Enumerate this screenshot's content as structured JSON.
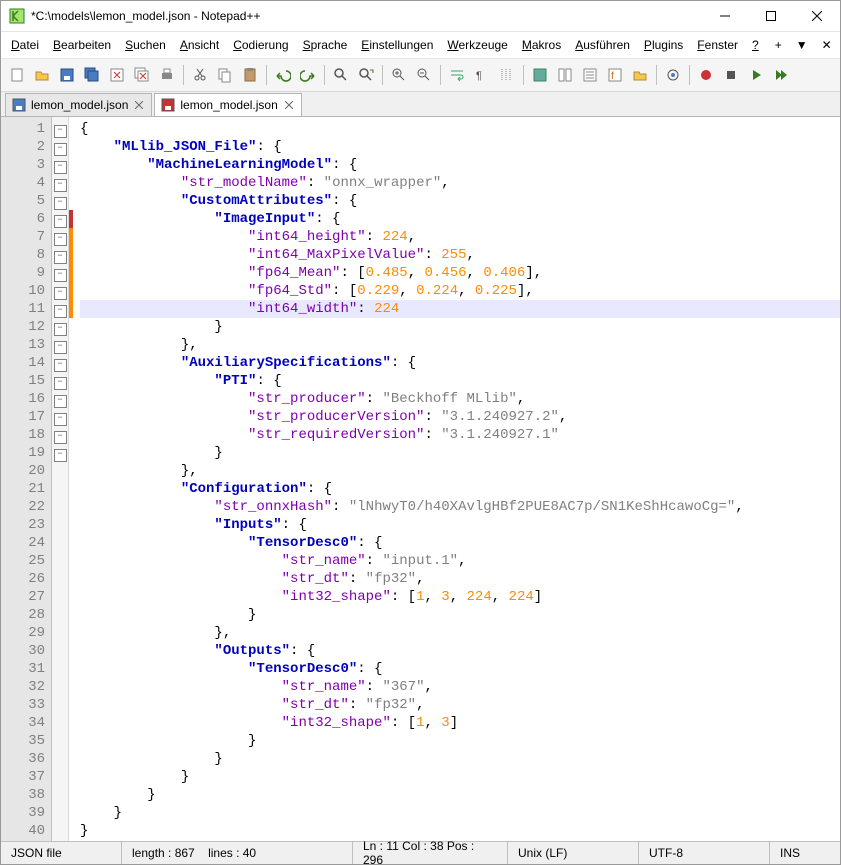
{
  "window": {
    "title": "*C:\\models\\lemon_model.json - Notepad++"
  },
  "menu": {
    "items": [
      "Datei",
      "Bearbeiten",
      "Suchen",
      "Ansicht",
      "Codierung",
      "Sprache",
      "Einstellungen",
      "Werkzeuge",
      "Makros",
      "Ausführen",
      "Plugins",
      "Fenster",
      "?"
    ]
  },
  "tabs": [
    {
      "label": "lemon_model.json",
      "modified": false,
      "active": false
    },
    {
      "label": "lemon_model.json",
      "modified": true,
      "active": true
    }
  ],
  "editor": {
    "current_line": 11,
    "change_marks": {
      "red": [
        6
      ],
      "orange": [
        7,
        8,
        9,
        10,
        11
      ]
    },
    "lines": [
      {
        "n": 1,
        "fold": "-",
        "html": "<span class='b'>{</span>"
      },
      {
        "n": 2,
        "fold": "-",
        "html": "    <span class='kb'>\"MLlib_JSON_File\"</span><span class='b'>: {</span>"
      },
      {
        "n": 3,
        "fold": "-",
        "html": "        <span class='kb'>\"MachineLearningModel\"</span><span class='b'>: {</span>"
      },
      {
        "n": 4,
        "fold": "",
        "html": "            <span class='p'>\"str_modelName\"</span><span class='b'>: </span><span class='s'>\"onnx_wrapper\"</span><span class='b'>,</span>"
      },
      {
        "n": 5,
        "fold": "-",
        "html": "            <span class='kb'>\"CustomAttributes\"</span><span class='b'>: {</span>"
      },
      {
        "n": 6,
        "fold": "-",
        "html": "                <span class='kb'>\"ImageInput\"</span><span class='b'>: {</span>"
      },
      {
        "n": 7,
        "fold": "",
        "html": "                    <span class='p'>\"int64_height\"</span><span class='b'>: </span><span class='n'>224</span><span class='b'>,</span>"
      },
      {
        "n": 8,
        "fold": "",
        "html": "                    <span class='p'>\"int64_MaxPixelValue\"</span><span class='b'>: </span><span class='n'>255</span><span class='b'>,</span>"
      },
      {
        "n": 9,
        "fold": "",
        "html": "                    <span class='p'>\"fp64_Mean\"</span><span class='b'>: [</span><span class='n'>0.485</span><span class='b'>, </span><span class='n'>0.456</span><span class='b'>, </span><span class='n'>0.406</span><span class='b'>],</span>"
      },
      {
        "n": 10,
        "fold": "",
        "html": "                    <span class='p'>\"fp64_Std\"</span><span class='b'>: [</span><span class='n'>0.229</span><span class='b'>, </span><span class='n'>0.224</span><span class='b'>, </span><span class='n'>0.225</span><span class='b'>],</span>"
      },
      {
        "n": 11,
        "fold": "",
        "html": "                    <span class='p'>\"int64_width\"</span><span class='b'>: </span><span class='n'>224</span>"
      },
      {
        "n": 12,
        "fold": "-",
        "html": "                <span class='b'>}</span>"
      },
      {
        "n": 13,
        "fold": "",
        "html": "            <span class='b'>},</span>"
      },
      {
        "n": 14,
        "fold": "-",
        "html": "            <span class='kb'>\"AuxiliarySpecifications\"</span><span class='b'>: {</span>"
      },
      {
        "n": 15,
        "fold": "-",
        "html": "                <span class='kb'>\"PTI\"</span><span class='b'>: {</span>"
      },
      {
        "n": 16,
        "fold": "",
        "html": "                    <span class='p'>\"str_producer\"</span><span class='b'>: </span><span class='s'>\"Beckhoff MLlib\"</span><span class='b'>,</span>"
      },
      {
        "n": 17,
        "fold": "",
        "html": "                    <span class='p'>\"str_producerVersion\"</span><span class='b'>: </span><span class='s'>\"3.1.240927.2\"</span><span class='b'>,</span>"
      },
      {
        "n": 18,
        "fold": "",
        "html": "                    <span class='p'>\"str_requiredVersion\"</span><span class='b'>: </span><span class='s'>\"3.1.240927.1\"</span>"
      },
      {
        "n": 19,
        "fold": "-",
        "html": "                <span class='b'>}</span>"
      },
      {
        "n": 20,
        "fold": "",
        "html": "            <span class='b'>},</span>"
      },
      {
        "n": 21,
        "fold": "-",
        "html": "            <span class='kb'>\"Configuration\"</span><span class='b'>: {</span>"
      },
      {
        "n": 22,
        "fold": "",
        "html": "                <span class='p'>\"str_onnxHash\"</span><span class='b'>: </span><span class='s'>\"lNhwyT0/h40XAvlgHBf2PUE8AC7p/SN1KeShHcawoCg=\"</span><span class='b'>,</span>"
      },
      {
        "n": 23,
        "fold": "-",
        "html": "                <span class='kb'>\"Inputs\"</span><span class='b'>: {</span>"
      },
      {
        "n": 24,
        "fold": "-",
        "html": "                    <span class='kb'>\"TensorDesc0\"</span><span class='b'>: {</span>"
      },
      {
        "n": 25,
        "fold": "",
        "html": "                        <span class='p'>\"str_name\"</span><span class='b'>: </span><span class='s'>\"input.1\"</span><span class='b'>,</span>"
      },
      {
        "n": 26,
        "fold": "",
        "html": "                        <span class='p'>\"str_dt\"</span><span class='b'>: </span><span class='s'>\"fp32\"</span><span class='b'>,</span>"
      },
      {
        "n": 27,
        "fold": "",
        "html": "                        <span class='p'>\"int32_shape\"</span><span class='b'>: [</span><span class='n'>1</span><span class='b'>, </span><span class='n'>3</span><span class='b'>, </span><span class='n'>224</span><span class='b'>, </span><span class='n'>224</span><span class='b'>]</span>"
      },
      {
        "n": 28,
        "fold": "-",
        "html": "                    <span class='b'>}</span>"
      },
      {
        "n": 29,
        "fold": "",
        "html": "                <span class='b'>},</span>"
      },
      {
        "n": 30,
        "fold": "-",
        "html": "                <span class='kb'>\"Outputs\"</span><span class='b'>: {</span>"
      },
      {
        "n": 31,
        "fold": "-",
        "html": "                    <span class='kb'>\"TensorDesc0\"</span><span class='b'>: {</span>"
      },
      {
        "n": 32,
        "fold": "",
        "html": "                        <span class='p'>\"str_name\"</span><span class='b'>: </span><span class='s'>\"367\"</span><span class='b'>,</span>"
      },
      {
        "n": 33,
        "fold": "",
        "html": "                        <span class='p'>\"str_dt\"</span><span class='b'>: </span><span class='s'>\"fp32\"</span><span class='b'>,</span>"
      },
      {
        "n": 34,
        "fold": "",
        "html": "                        <span class='p'>\"int32_shape\"</span><span class='b'>: [</span><span class='n'>1</span><span class='b'>, </span><span class='n'>3</span><span class='b'>]</span>"
      },
      {
        "n": 35,
        "fold": "-",
        "html": "                    <span class='b'>}</span>"
      },
      {
        "n": 36,
        "fold": "-",
        "html": "                <span class='b'>}</span>"
      },
      {
        "n": 37,
        "fold": "-",
        "html": "            <span class='b'>}</span>"
      },
      {
        "n": 38,
        "fold": "-",
        "html": "        <span class='b'>}</span>"
      },
      {
        "n": 39,
        "fold": "",
        "html": "    <span class='b'>}</span>"
      },
      {
        "n": 40,
        "fold": "",
        "html": "<span class='b'>}</span>"
      }
    ]
  },
  "status": {
    "type": "JSON file",
    "length": "length : 867",
    "lines": "lines : 40",
    "pos": "Ln : 11    Col : 38    Pos : 296",
    "eol": "Unix (LF)",
    "enc": "UTF-8",
    "mode": "INS"
  },
  "toolbar_icons": [
    "new",
    "open",
    "save",
    "save-all",
    "close",
    "close-all",
    "print",
    "|",
    "cut",
    "copy",
    "paste",
    "|",
    "undo",
    "redo",
    "|",
    "find",
    "replace",
    "|",
    "zoom-in",
    "zoom-out",
    "|",
    "wrap",
    "all-chars",
    "indent-guide",
    "|",
    "lang",
    "doc-map",
    "doc-list",
    "func-list",
    "folder",
    "|",
    "monitor",
    "|",
    "record",
    "stop",
    "play",
    "play-multi"
  ]
}
